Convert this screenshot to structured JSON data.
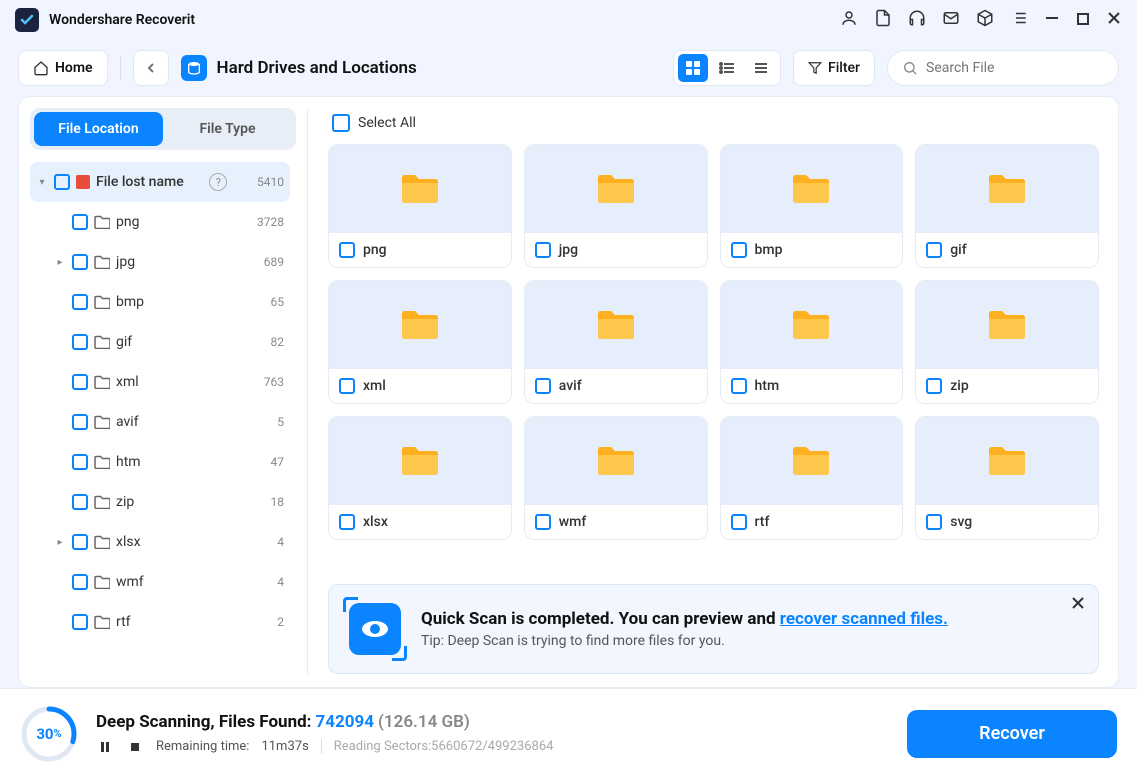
{
  "app": {
    "title": "Wondershare Recoverit"
  },
  "toolbar": {
    "home": "Home",
    "breadcrumb": "Hard Drives and Locations",
    "filter": "Filter",
    "search_placeholder": "Search File"
  },
  "sidebar": {
    "tabs": {
      "location": "File Location",
      "type": "File Type"
    },
    "root": {
      "label": "File lost name",
      "count": "5410"
    },
    "items": [
      {
        "label": "png",
        "count": "3728",
        "expandable": false
      },
      {
        "label": "jpg",
        "count": "689",
        "expandable": true
      },
      {
        "label": "bmp",
        "count": "65",
        "expandable": false
      },
      {
        "label": "gif",
        "count": "82",
        "expandable": false
      },
      {
        "label": "xml",
        "count": "763",
        "expandable": false
      },
      {
        "label": "avif",
        "count": "5",
        "expandable": false
      },
      {
        "label": "htm",
        "count": "47",
        "expandable": false
      },
      {
        "label": "zip",
        "count": "18",
        "expandable": false
      },
      {
        "label": "xlsx",
        "count": "4",
        "expandable": true
      },
      {
        "label": "wmf",
        "count": "4",
        "expandable": false
      },
      {
        "label": "rtf",
        "count": "2",
        "expandable": false
      }
    ]
  },
  "content": {
    "select_all": "Select All",
    "folders": [
      "png",
      "jpg",
      "bmp",
      "gif",
      "xml",
      "avif",
      "htm",
      "zip",
      "xlsx",
      "wmf",
      "rtf",
      "svg"
    ]
  },
  "banner": {
    "title_prefix": "Quick Scan is completed. You can preview and ",
    "title_link": "recover scanned files.",
    "tip": "Tip: Deep Scan is trying to find more files for you."
  },
  "scan": {
    "percent": "30",
    "percent_suffix": "%",
    "label": "Deep Scanning, Files Found: ",
    "found": "742094",
    "size": "(126.14 GB)",
    "remaining_label": "Remaining time:",
    "remaining_value": "11m37s",
    "sectors": "Reading Sectors:5660672/499236864",
    "recover": "Recover"
  }
}
